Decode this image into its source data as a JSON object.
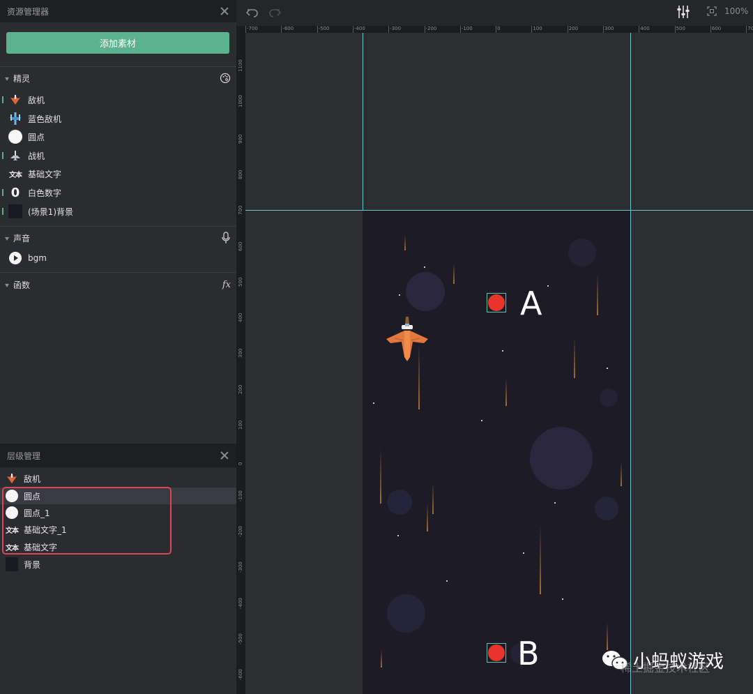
{
  "asset_panel": {
    "title": "资源管理器",
    "add_button": "添加素材",
    "sections": {
      "sprites": "精灵",
      "sounds": "声音",
      "functions": "函数"
    },
    "sprites": [
      {
        "label": "敌机",
        "icon": "enemy-plane-icon"
      },
      {
        "label": "蓝色敌机",
        "icon": "blue-enemy-plane-icon"
      },
      {
        "label": "圆点",
        "icon": "white-circle-icon"
      },
      {
        "label": "战机",
        "icon": "fighter-plane-icon"
      },
      {
        "label": "基础文字",
        "icon": "text-icon"
      },
      {
        "label": "白色数字",
        "icon": "digit-zero-icon"
      },
      {
        "label": "(场景1)背景",
        "icon": "background-thumb-icon"
      }
    ],
    "sounds": [
      {
        "label": "bgm",
        "icon": "play-icon"
      }
    ],
    "text_icon_glyph": "文本",
    "zero_glyph": "0",
    "fx_glyph": "fx"
  },
  "layer_panel": {
    "title": "层级管理",
    "layers": [
      {
        "label": "敌机"
      },
      {
        "label": "圆点"
      },
      {
        "label": "圆点_1"
      },
      {
        "label": "基础文字_1"
      },
      {
        "label": "基础文字"
      },
      {
        "label": "背景"
      }
    ]
  },
  "toolbar": {
    "zoom": "100%"
  },
  "ruler": {
    "top_ticks": [
      "-700",
      "-600",
      "-500",
      "-400",
      "-300",
      "-200",
      "-100",
      "0",
      "100",
      "200",
      "300",
      "400",
      "500",
      "600",
      "700"
    ],
    "left_ticks": [
      "1100",
      "1000",
      "900",
      "800",
      "700",
      "600",
      "500",
      "400",
      "300",
      "200",
      "100",
      "0",
      "-100",
      "-200",
      "-300",
      "-400",
      "-500",
      "-600"
    ]
  },
  "scene": {
    "label_a": "A",
    "label_b": "B"
  },
  "watermark": {
    "text": "小蚂蚁游戏",
    "sub": "稀土掘金技术社区"
  },
  "colors": {
    "accent": "#5bb28c",
    "guide": "#63c9c9",
    "highlight": "#d9475a",
    "dot": "#e8342b"
  }
}
